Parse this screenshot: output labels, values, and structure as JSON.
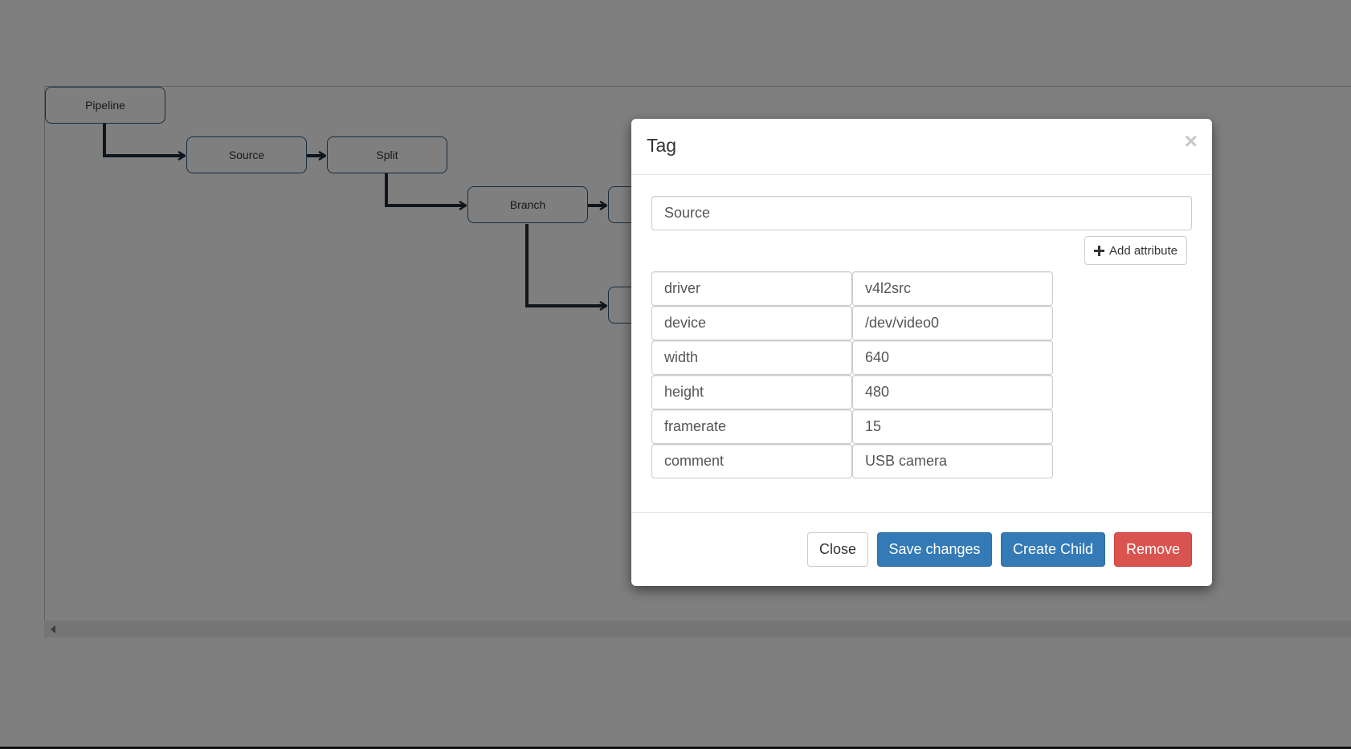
{
  "tree": {
    "nodes": [
      {
        "id": "pipeline",
        "label": "Pipeline"
      },
      {
        "id": "source",
        "label": "Source"
      },
      {
        "id": "split",
        "label": "Split"
      },
      {
        "id": "branch",
        "label": "Branch"
      },
      {
        "id": "child-a",
        "label": ""
      },
      {
        "id": "child-b",
        "label": ""
      }
    ]
  },
  "modal": {
    "title": "Tag",
    "close_icon": "close-icon",
    "name_value": "Source",
    "add_attribute_label": "Add attribute",
    "add_icon": "plus-icon",
    "attributes": [
      {
        "key": "driver",
        "value": "v4l2src"
      },
      {
        "key": "device",
        "value": "/dev/video0"
      },
      {
        "key": "width",
        "value": "640"
      },
      {
        "key": "height",
        "value": "480"
      },
      {
        "key": "framerate",
        "value": "15"
      },
      {
        "key": "comment",
        "value": "USB camera"
      }
    ],
    "footer": {
      "close_label": "Close",
      "save_label": "Save changes",
      "create_child_label": "Create Child",
      "remove_label": "Remove"
    }
  },
  "colors": {
    "primary": "#337ab7",
    "danger": "#d9534f",
    "node_border": "#2f5a82",
    "connector": "#1f2d3d"
  }
}
